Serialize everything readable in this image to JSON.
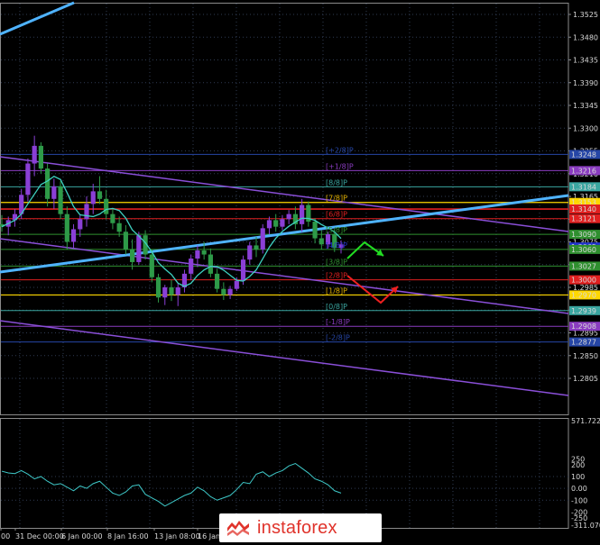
{
  "chart_data": [
    {
      "type": "candlestick",
      "y_ticks": [
        "1.3525",
        "1.3480",
        "1.3435",
        "1.3390",
        "1.3345",
        "1.3300",
        "1.3255",
        "1.3210",
        "1.3165",
        "1.3120",
        "1.3075",
        "1.3030",
        "1.2985",
        "1.2940",
        "1.2895",
        "1.2850",
        "1.2805"
      ],
      "ylim": [
        1.2805,
        1.3525
      ],
      "x_ticks": [
        "00",
        "31 Dec 00:00",
        "6 Jan 00:00",
        "8 Jan 16:00",
        "13 Jan 08:00",
        "16 Jan"
      ],
      "murrey_labels": [
        "[+2/8]P",
        "[+1/8]P",
        "[8/8]P",
        "[7/8]P",
        "[6/8]P",
        "[5/8]P",
        "[4/8]P",
        "[3/8]P",
        "[2/8]P",
        "[1/8]P",
        "[0/8]P",
        "[-1/8]P",
        "[-2/8]P"
      ],
      "price_boxes": [
        {
          "text": "1.3248",
          "value": 1.3248,
          "color": "#2646a6"
        },
        {
          "text": "1.3216",
          "value": 1.3216,
          "color": "#8a3cc0"
        },
        {
          "text": "1.3184",
          "value": 1.3184,
          "color": "#3aa6a0"
        },
        {
          "text": "1.3153",
          "value": 1.3153,
          "color": "#ffd800"
        },
        {
          "text": "1.3140",
          "value": 1.314,
          "color": "#e02020"
        },
        {
          "text": "1.3121",
          "value": 1.3121,
          "color": "#e02020"
        },
        {
          "text": "1.3090",
          "value": 1.309,
          "color": "#2f8f2f"
        },
        {
          "text": "1.3065",
          "value": 1.3065,
          "color": "#2233cc"
        },
        {
          "text": "1.3060",
          "value": 1.306,
          "color": "#2f8f2f"
        },
        {
          "text": "1.3027",
          "value": 1.3027,
          "color": "#2f8f2f"
        },
        {
          "text": "1.3000",
          "value": 1.3,
          "color": "#e02020"
        },
        {
          "text": "1.2970",
          "value": 1.297,
          "color": "#ffd800"
        },
        {
          "text": "1.2939",
          "value": 1.2939,
          "color": "#3aa6a0"
        },
        {
          "text": "1.2908",
          "value": 1.2908,
          "color": "#8a3cc0"
        },
        {
          "text": "1.2877",
          "value": 1.2877,
          "color": "#2646a6"
        }
      ],
      "candles": [
        {
          "o": 1.311,
          "h": 1.3128,
          "l": 1.3095,
          "c": 1.3105
        },
        {
          "o": 1.3105,
          "h": 1.3125,
          "l": 1.3088,
          "c": 1.3118
        },
        {
          "o": 1.3118,
          "h": 1.314,
          "l": 1.3105,
          "c": 1.313
        },
        {
          "o": 1.313,
          "h": 1.318,
          "l": 1.312,
          "c": 1.3168
        },
        {
          "o": 1.3168,
          "h": 1.324,
          "l": 1.3155,
          "c": 1.323
        },
        {
          "o": 1.323,
          "h": 1.3285,
          "l": 1.3205,
          "c": 1.3265
        },
        {
          "o": 1.3265,
          "h": 1.3272,
          "l": 1.321,
          "c": 1.322
        },
        {
          "o": 1.322,
          "h": 1.323,
          "l": 1.3145,
          "c": 1.316
        },
        {
          "o": 1.316,
          "h": 1.32,
          "l": 1.314,
          "c": 1.3185
        },
        {
          "o": 1.3185,
          "h": 1.3195,
          "l": 1.312,
          "c": 1.313
        },
        {
          "o": 1.313,
          "h": 1.3145,
          "l": 1.306,
          "c": 1.3075
        },
        {
          "o": 1.3075,
          "h": 1.311,
          "l": 1.3062,
          "c": 1.31
        },
        {
          "o": 1.31,
          "h": 1.313,
          "l": 1.3085,
          "c": 1.312
        },
        {
          "o": 1.312,
          "h": 1.3165,
          "l": 1.3105,
          "c": 1.315
        },
        {
          "o": 1.315,
          "h": 1.319,
          "l": 1.313,
          "c": 1.3175
        },
        {
          "o": 1.3175,
          "h": 1.3205,
          "l": 1.315,
          "c": 1.316
        },
        {
          "o": 1.316,
          "h": 1.3178,
          "l": 1.312,
          "c": 1.313
        },
        {
          "o": 1.313,
          "h": 1.3142,
          "l": 1.31,
          "c": 1.3112
        },
        {
          "o": 1.3112,
          "h": 1.3125,
          "l": 1.3085,
          "c": 1.3095
        },
        {
          "o": 1.3095,
          "h": 1.3108,
          "l": 1.305,
          "c": 1.306
        },
        {
          "o": 1.306,
          "h": 1.308,
          "l": 1.302,
          "c": 1.3035
        },
        {
          "o": 1.3035,
          "h": 1.3095,
          "l": 1.303,
          "c": 1.3088
        },
        {
          "o": 1.3088,
          "h": 1.3098,
          "l": 1.304,
          "c": 1.305
        },
        {
          "o": 1.305,
          "h": 1.306,
          "l": 1.2995,
          "c": 1.3005
        },
        {
          "o": 1.3005,
          "h": 1.3012,
          "l": 1.2955,
          "c": 1.2965
        },
        {
          "o": 1.2965,
          "h": 1.299,
          "l": 1.295,
          "c": 1.2985
        },
        {
          "o": 1.2985,
          "h": 1.3,
          "l": 1.2958,
          "c": 1.297
        },
        {
          "o": 1.297,
          "h": 1.2992,
          "l": 1.2948,
          "c": 1.2985
        },
        {
          "o": 1.2985,
          "h": 1.302,
          "l": 1.2975,
          "c": 1.3012
        },
        {
          "o": 1.3012,
          "h": 1.305,
          "l": 1.3,
          "c": 1.3042
        },
        {
          "o": 1.3042,
          "h": 1.3068,
          "l": 1.3025,
          "c": 1.3058
        },
        {
          "o": 1.3058,
          "h": 1.3075,
          "l": 1.304,
          "c": 1.305
        },
        {
          "o": 1.305,
          "h": 1.3062,
          "l": 1.3005,
          "c": 1.3012
        },
        {
          "o": 1.3012,
          "h": 1.3022,
          "l": 1.2975,
          "c": 1.2982
        },
        {
          "o": 1.2982,
          "h": 1.2995,
          "l": 1.296,
          "c": 1.297
        },
        {
          "o": 1.297,
          "h": 1.2988,
          "l": 1.2962,
          "c": 1.2982
        },
        {
          "o": 1.2982,
          "h": 1.3005,
          "l": 1.2978,
          "c": 1.2998
        },
        {
          "o": 1.2998,
          "h": 1.3048,
          "l": 1.299,
          "c": 1.304
        },
        {
          "o": 1.304,
          "h": 1.3075,
          "l": 1.303,
          "c": 1.3068
        },
        {
          "o": 1.3068,
          "h": 1.3085,
          "l": 1.3045,
          "c": 1.306
        },
        {
          "o": 1.306,
          "h": 1.311,
          "l": 1.3052,
          "c": 1.3102
        },
        {
          "o": 1.3102,
          "h": 1.3125,
          "l": 1.309,
          "c": 1.3118
        },
        {
          "o": 1.3118,
          "h": 1.313,
          "l": 1.3095,
          "c": 1.3105
        },
        {
          "o": 1.3105,
          "h": 1.3128,
          "l": 1.3098,
          "c": 1.312
        },
        {
          "o": 1.312,
          "h": 1.3138,
          "l": 1.311,
          "c": 1.313
        },
        {
          "o": 1.313,
          "h": 1.3145,
          "l": 1.31,
          "c": 1.311
        },
        {
          "o": 1.311,
          "h": 1.316,
          "l": 1.3095,
          "c": 1.3148
        },
        {
          "o": 1.3148,
          "h": 1.3155,
          "l": 1.3105,
          "c": 1.3115
        },
        {
          "o": 1.3115,
          "h": 1.3122,
          "l": 1.3072,
          "c": 1.3082
        },
        {
          "o": 1.3082,
          "h": 1.3098,
          "l": 1.306,
          "c": 1.307
        },
        {
          "o": 1.307,
          "h": 1.3095,
          "l": 1.3062,
          "c": 1.309
        },
        {
          "o": 1.309,
          "h": 1.31,
          "l": 1.3055,
          "c": 1.3063
        },
        {
          "o": 1.3063,
          "h": 1.3078,
          "l": 1.3052,
          "c": 1.307
        }
      ],
      "oscillator": {
        "y_ticks": [
          "571.7224",
          "250",
          "200",
          "100",
          "0.00",
          "-100",
          "-200",
          "-250",
          "-311.0709"
        ],
        "ylim": [
          -311.0709,
          571.7224
        ],
        "values": [
          145,
          130,
          125,
          150,
          120,
          80,
          100,
          60,
          30,
          40,
          10,
          -20,
          20,
          0,
          40,
          60,
          10,
          -40,
          -60,
          -30,
          20,
          30,
          -50,
          -80,
          -110,
          -150,
          -120,
          -90,
          -60,
          -40,
          10,
          -20,
          -70,
          -100,
          -80,
          -60,
          -10,
          50,
          40,
          120,
          140,
          100,
          130,
          150,
          190,
          210,
          170,
          130,
          80,
          60,
          30,
          -20,
          -40
        ]
      }
    }
  ],
  "logo": {
    "text": "instaforex"
  }
}
